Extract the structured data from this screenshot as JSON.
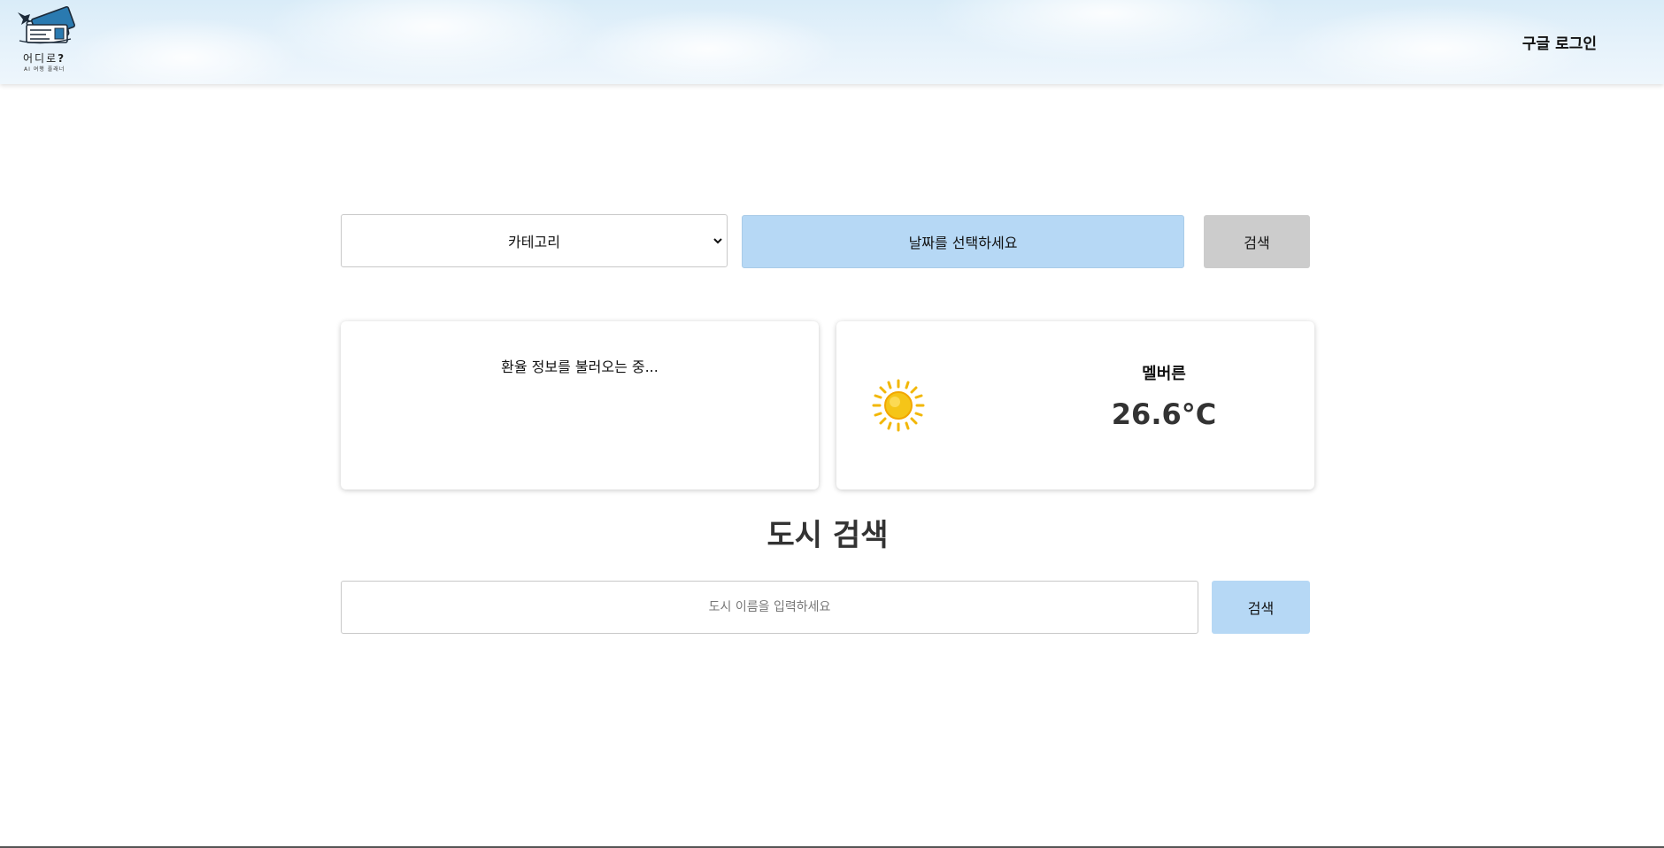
{
  "header": {
    "logo_title_main": "어디로",
    "logo_title_mark": "?",
    "logo_subtitle": "AI 여행 플래너",
    "login_label": "구글 로그인"
  },
  "search_bar": {
    "category_label": "카테고리",
    "date_label": "날짜를 선택하세요",
    "search_label": "검색"
  },
  "exchange_card": {
    "status_text": "환율 정보를 불러오는 중..."
  },
  "weather_card": {
    "icon": "sun-icon",
    "city": "멜버른",
    "temperature": "26.6°C"
  },
  "city_search": {
    "title": "도시 검색",
    "placeholder": "도시 이름을 입력하세요",
    "value": "",
    "search_label": "검색"
  },
  "colors": {
    "accent_blue": "#b6d8f5",
    "disabled_gray": "#cccccc",
    "sun_yellow": "#f5c518"
  }
}
